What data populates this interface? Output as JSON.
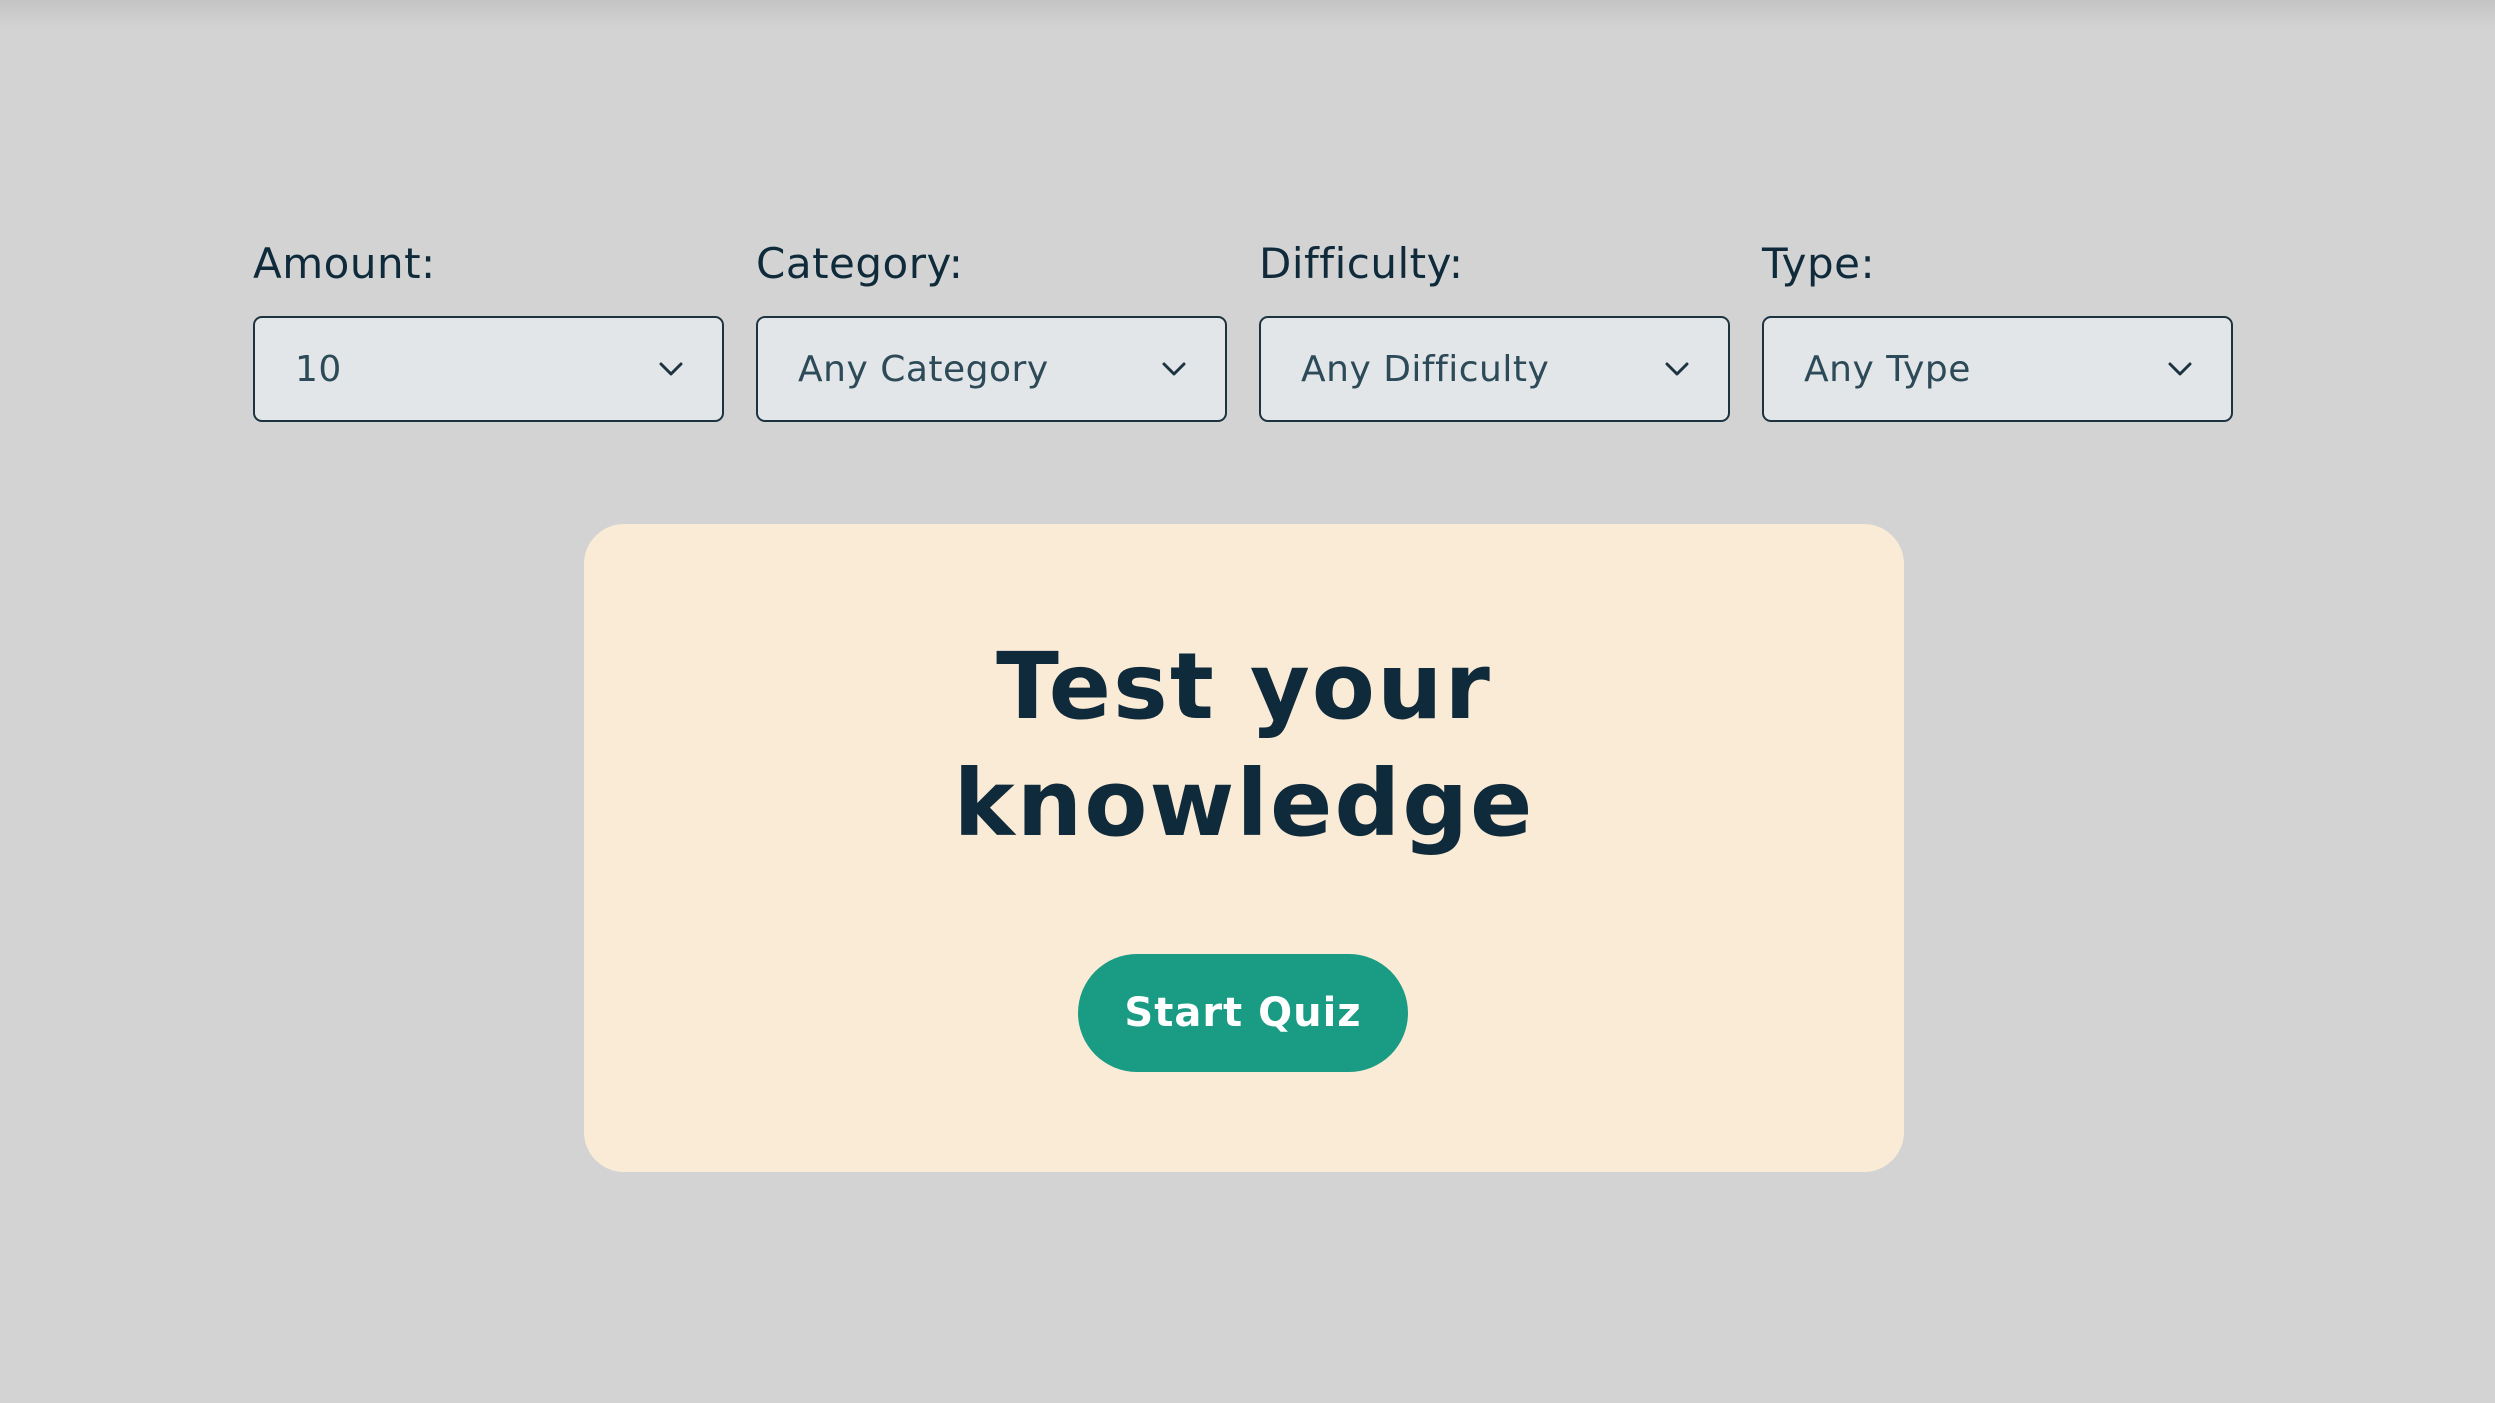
{
  "filters": [
    {
      "label": "Amount:",
      "value": "10"
    },
    {
      "label": "Category:",
      "value": "Any Category"
    },
    {
      "label": "Difficulty:",
      "value": "Any Difficulty"
    },
    {
      "label": "Type:",
      "value": "Any Type"
    }
  ],
  "hero": {
    "headline_line1": "Test your",
    "headline_line2": "knowledge",
    "start_label": "Start Quiz"
  },
  "colors": {
    "background": "#d3d3d3",
    "card": "#faebd7",
    "button": "#1a9b84",
    "text": "#0f2a3a"
  },
  "icons": {
    "select_arrow": "chevron-down-icon"
  }
}
